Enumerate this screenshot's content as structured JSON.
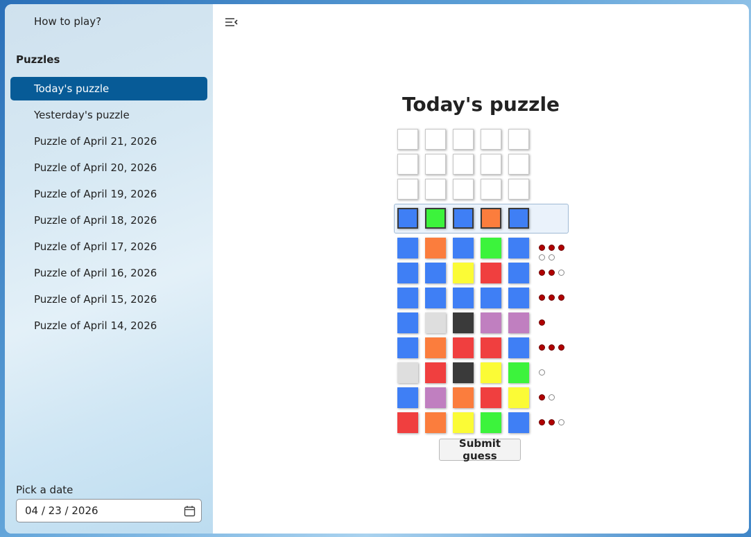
{
  "sidebar": {
    "help_link": "How to play?",
    "section_title": "Puzzles",
    "items": [
      {
        "label": "Today's puzzle",
        "active": true
      },
      {
        "label": "Yesterday's puzzle"
      },
      {
        "label": "Puzzle of April 21, 2026"
      },
      {
        "label": "Puzzle of April 20, 2026"
      },
      {
        "label": "Puzzle of April 19, 2026"
      },
      {
        "label": "Puzzle of April 18, 2026"
      },
      {
        "label": "Puzzle of April 17, 2026"
      },
      {
        "label": "Puzzle of April 16, 2026"
      },
      {
        "label": "Puzzle of April 15, 2026"
      },
      {
        "label": "Puzzle of April 14, 2026"
      }
    ],
    "date_label": "Pick a date",
    "date_value": "04 / 23 / 2026"
  },
  "main": {
    "title": "Today's puzzle",
    "submit_label": "Submit guess"
  },
  "colors": {
    "blue": "#3f7ff5",
    "orange": "#fb7d3d",
    "green": "#3cf33c",
    "red": "#f03f3f",
    "yellow": "#fbfb36",
    "gray": "#dedede",
    "dark": "#3a3a3a",
    "purple": "#c07fc0",
    "accent": "#075b97"
  },
  "board": {
    "empty_rows": 3,
    "current_guess": [
      "blue",
      "green",
      "blue",
      "orange",
      "blue"
    ],
    "current_selected_index": 3,
    "history": [
      {
        "pegs": [
          "blue",
          "orange",
          "blue",
          "green",
          "blue"
        ],
        "black": 3,
        "white": 2
      },
      {
        "pegs": [
          "blue",
          "blue",
          "yellow",
          "red",
          "blue"
        ],
        "black": 2,
        "white": 1
      },
      {
        "pegs": [
          "blue",
          "blue",
          "blue",
          "blue",
          "blue"
        ],
        "black": 3,
        "white": 0
      },
      {
        "pegs": [
          "blue",
          "gray",
          "dark",
          "purple",
          "purple"
        ],
        "black": 1,
        "white": 0
      },
      {
        "pegs": [
          "blue",
          "orange",
          "red",
          "red",
          "blue"
        ],
        "black": 3,
        "white": 0
      },
      {
        "pegs": [
          "gray",
          "red",
          "dark",
          "yellow",
          "green"
        ],
        "black": 0,
        "white": 1
      },
      {
        "pegs": [
          "blue",
          "purple",
          "orange",
          "red",
          "yellow"
        ],
        "black": 1,
        "white": 1
      },
      {
        "pegs": [
          "red",
          "orange",
          "yellow",
          "green",
          "blue"
        ],
        "black": 2,
        "white": 1
      }
    ]
  }
}
